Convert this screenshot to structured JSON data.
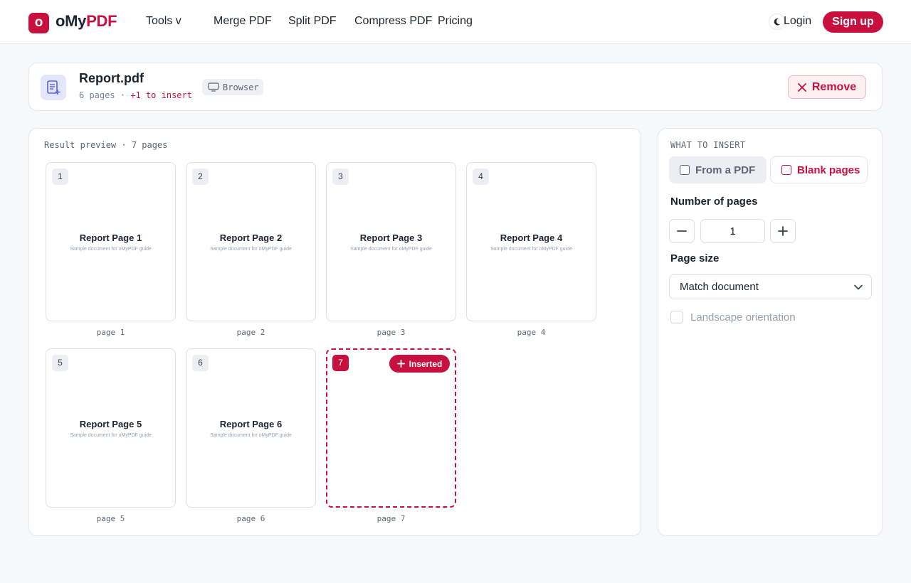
{
  "header": {
    "logo_badge": "o",
    "logo_part1": "oMy",
    "logo_part2": "PDF",
    "nav": [
      {
        "label": "Tools  v"
      },
      {
        "label": "Merge PDF"
      },
      {
        "label": "Split PDF"
      },
      {
        "label": "Compress PDF"
      },
      {
        "label": "Pricing"
      }
    ],
    "theme_icon": "moon-icon",
    "login": "Login",
    "signup": "Sign up"
  },
  "file": {
    "name": "Report.pdf",
    "pages": "6 pages",
    "sep": " · ",
    "insert_note": "+1 to insert",
    "source": "Browser",
    "remove": "Remove"
  },
  "preview": {
    "label": "Result preview · 7 pages",
    "pages": [
      {
        "num": "1",
        "title": "Report Page 1",
        "sub": "Sample document for oMyPDF guide",
        "caption": "page 1"
      },
      {
        "num": "2",
        "title": "Report Page 2",
        "sub": "Sample document for oMyPDF guide",
        "caption": "page 2"
      },
      {
        "num": "3",
        "title": "Report Page 3",
        "sub": "Sample document for oMyPDF guide",
        "caption": "page 3"
      },
      {
        "num": "4",
        "title": "Report Page 4",
        "sub": "Sample document for oMyPDF guide",
        "caption": "page 4"
      },
      {
        "num": "5",
        "title": "Report Page 5",
        "sub": "Sample document for oMyPDF guide",
        "caption": "page 5"
      },
      {
        "num": "6",
        "title": "Report Page 6",
        "sub": "Sample document for oMyPDF guide",
        "caption": "page 6"
      },
      {
        "num": "7",
        "badge": "Inserted",
        "caption": "page 7"
      }
    ]
  },
  "settings": {
    "what_label": "WHAT TO INSERT",
    "option_pdf": "From a PDF",
    "option_blank": "Blank pages",
    "selected_option": "Blank pages",
    "num_pages_label": "Number of pages",
    "num_pages_value": "1",
    "page_size_label": "Page size",
    "page_size_value": "Match document",
    "landscape_label": "Landscape orientation",
    "landscape_checked": false
  },
  "colors": {
    "accent": "#c8103f",
    "background": "#f7f8fa"
  }
}
